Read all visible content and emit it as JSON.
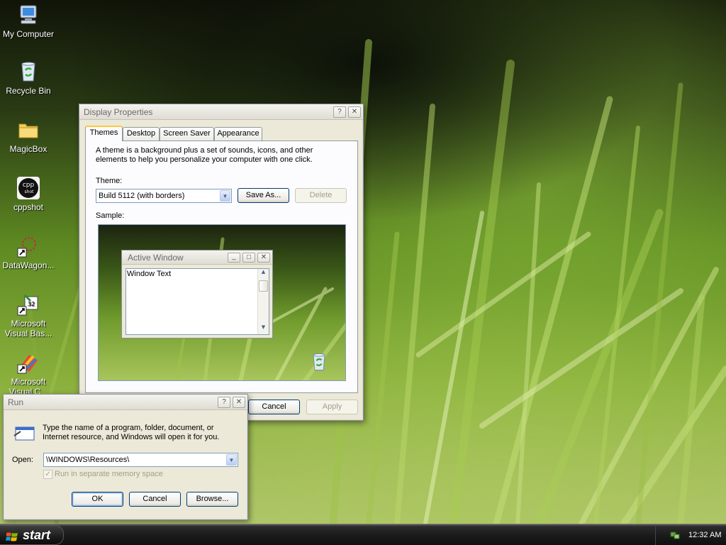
{
  "desktop": {
    "icons": [
      {
        "label": "My Computer",
        "icon": "my-computer-icon"
      },
      {
        "label": "Recycle Bin",
        "icon": "recycle-bin-icon"
      },
      {
        "label": "MagicBox",
        "icon": "folder-icon"
      },
      {
        "label": "cppshot",
        "icon": "cppshot-icon"
      },
      {
        "label": "DataWagon...",
        "icon": "datawagon-shortcut-icon"
      },
      {
        "label": "Microsoft Visual Bas...",
        "icon": "vb6-shortcut-icon"
      },
      {
        "label": "Microsoft Visual C...",
        "icon": "vc6-shortcut-icon"
      }
    ]
  },
  "display_properties": {
    "title": "Display Properties",
    "help_btn": "?",
    "close_btn": "✕",
    "tabs": [
      "Themes",
      "Desktop",
      "Screen Saver",
      "Appearance"
    ],
    "active_tab": "Themes",
    "description": "A theme is a background plus a set of sounds, icons, and other elements to help you personalize your computer with one click.",
    "theme_label": "Theme:",
    "theme_value": "Build 5112 (with borders)",
    "save_as": "Save As...",
    "delete": "Delete",
    "sample_label": "Sample:",
    "sample": {
      "window_title": "Active Window",
      "window_text": "Window Text"
    },
    "cancel": "Cancel",
    "apply": "Apply"
  },
  "run_dialog": {
    "title": "Run",
    "help_btn": "?",
    "close_btn": "✕",
    "description": "Type the name of a program, folder, document, or Internet resource, and Windows will open it for you.",
    "open_label": "Open:",
    "open_value": "\\WINDOWS\\Resources\\",
    "separate_memory": "Run in separate memory space",
    "ok": "OK",
    "cancel": "Cancel",
    "browse": "Browse..."
  },
  "taskbar": {
    "start_label": "start",
    "clock": "12:32 AM"
  }
}
